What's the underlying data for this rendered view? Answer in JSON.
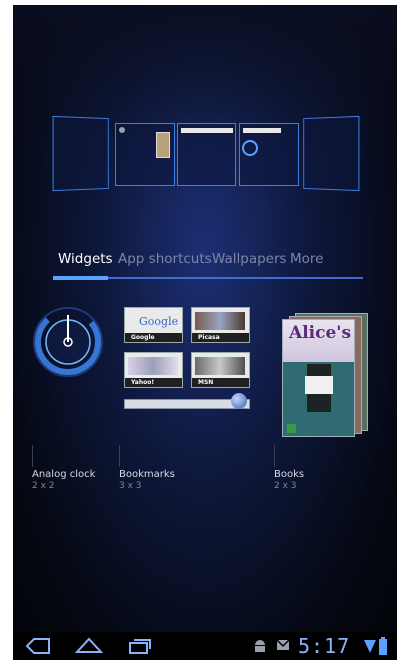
{
  "tabs": [
    {
      "label": "Widgets",
      "active": true
    },
    {
      "label": "App shortcuts",
      "active": false
    },
    {
      "label": "Wallpapers",
      "active": false
    },
    {
      "label": "More",
      "active": false
    }
  ],
  "widgets": [
    {
      "label": "Analog clock",
      "size": "2 x 2"
    },
    {
      "label": "Bookmarks",
      "size": "3 x 3"
    },
    {
      "label": "Books",
      "size": "2 x 3"
    }
  ],
  "bookmarks": [
    "Google",
    "Picasa",
    "Yahoo!",
    "MSN"
  ],
  "bookmark_google_logo": "Google",
  "book_title": "Alice's",
  "status": {
    "time": "5:17"
  },
  "icons": [
    "back-icon",
    "home-icon",
    "recent-apps-icon",
    "android-icon",
    "gmail-icon",
    "wifi-icon",
    "battery-icon"
  ],
  "colors": {
    "accent": "#5aa2ff",
    "background": "#0d1637"
  }
}
